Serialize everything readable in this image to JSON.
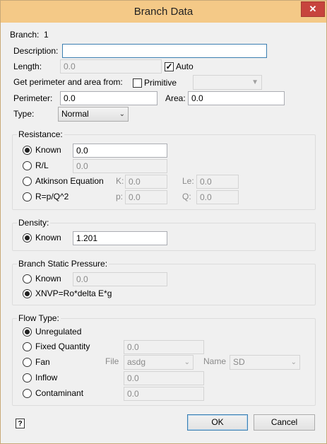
{
  "window": {
    "title": "Branch Data",
    "close_glyph": "✕"
  },
  "branch": {
    "label": "Branch:",
    "id": "1"
  },
  "description": {
    "label": "Description:",
    "value": ""
  },
  "length": {
    "label": "Length:",
    "value": "0.0",
    "auto_label": "Auto",
    "auto_checked": true
  },
  "perimeter_area": {
    "label": "Get perimeter and area from:",
    "primitive_label": "Primitive",
    "primitive_checked": false,
    "primitive_select": "",
    "perimeter_label": "Perimeter:",
    "perimeter_value": "0.0",
    "area_label": "Area:",
    "area_value": "0.0"
  },
  "type": {
    "label": "Type:",
    "value": "Normal"
  },
  "resistance": {
    "title": "Resistance:",
    "known_label": "Known",
    "known_value": "0.0",
    "rl_label": "R/L",
    "rl_value": "0.0",
    "atkinson_label": "Atkinson Equation",
    "k_label": "K:",
    "k_value": "0.0",
    "le_label": "Le:",
    "le_value": "0.0",
    "rpq_label": "R=p/Q^2",
    "p_label": "p:",
    "p_value": "0.0",
    "q_label": "Q:",
    "q_value": "0.0",
    "selected": "known"
  },
  "density": {
    "title": "Density:",
    "known_label": "Known",
    "known_value": "1.201"
  },
  "static_pressure": {
    "title": "Branch Static Pressure:",
    "known_label": "Known",
    "known_value": "0.0",
    "xnvp_label": "XNVP=Ro*delta E*g",
    "selected": "xnvp"
  },
  "flow_type": {
    "title": "Flow Type:",
    "unregulated_label": "Unregulated",
    "fixed_label": "Fixed Quantity",
    "fixed_value": "0.0",
    "fan_label": "Fan",
    "file_label": "File",
    "file_value": "asdg",
    "name_label": "Name",
    "name_value": "SD",
    "inflow_label": "Inflow",
    "inflow_value": "0.0",
    "contaminant_label": "Contaminant",
    "contaminant_value": "0.0",
    "selected": "unregulated"
  },
  "footer": {
    "help_glyph": "?",
    "ok_label": "OK",
    "cancel_label": "Cancel"
  },
  "colors": {
    "titlebar": "#f4c987",
    "close": "#c7443d",
    "accent": "#3c7fb1"
  }
}
